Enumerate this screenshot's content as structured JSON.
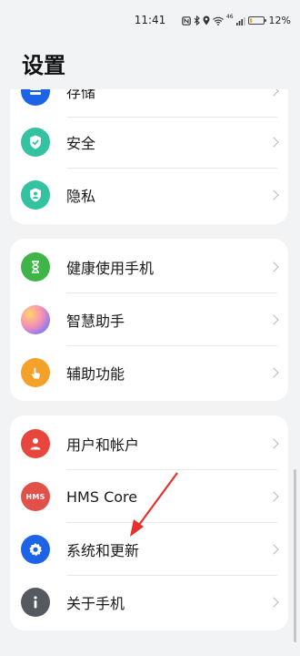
{
  "status": {
    "time": "11:41",
    "battery": "12%",
    "battery_level": 0.12,
    "net_speed": "46"
  },
  "title": "设置",
  "card1": {
    "items": [
      {
        "label": "存储",
        "icon": "storage-icon",
        "color": "#1d63e8"
      },
      {
        "label": "安全",
        "icon": "shield-check-icon",
        "color": "#34c3a0"
      },
      {
        "label": "隐私",
        "icon": "privacy-person-shield-icon",
        "color": "#34c3a0"
      }
    ]
  },
  "card2": {
    "items": [
      {
        "label": "健康使用手机",
        "icon": "hourglass-icon",
        "color": "#3fb549"
      },
      {
        "label": "智慧助手",
        "icon": "assistant-orb-icon",
        "color": "#e98bb6"
      },
      {
        "label": "辅助功能",
        "icon": "hand-tap-icon",
        "color": "#f4a12a"
      }
    ]
  },
  "card3": {
    "items": [
      {
        "label": "用户和帐户",
        "icon": "user-icon",
        "color": "#e8453c"
      },
      {
        "label": "HMS Core",
        "icon": "hms-icon",
        "icon_text": "HMS",
        "color": "#e2504a"
      },
      {
        "label": "系统和更新",
        "icon": "gear-icon",
        "color": "#1d63e8"
      },
      {
        "label": "关于手机",
        "icon": "info-icon",
        "color": "#555a60"
      }
    ]
  },
  "annotation": {
    "color": "#e8302a"
  }
}
